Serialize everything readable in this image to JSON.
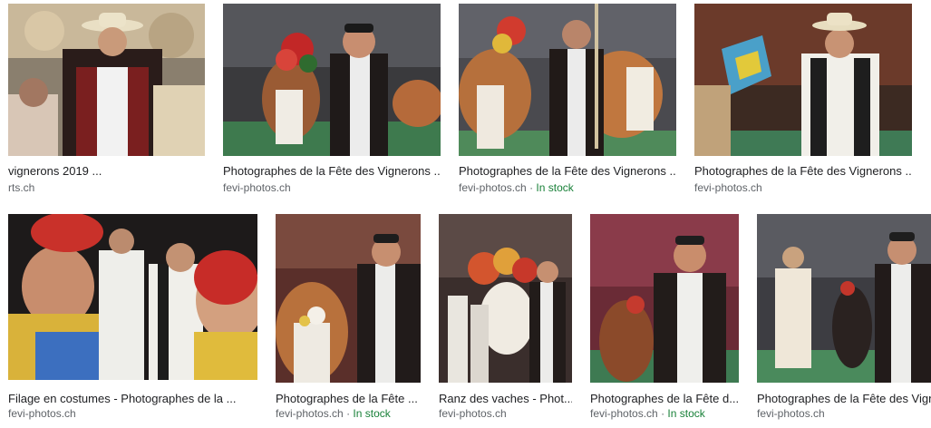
{
  "results": [
    {
      "title": "vignerons 2019 ...",
      "source": "rts.ch",
      "in_stock": ""
    },
    {
      "title": "Photographes de la Fête des Vignerons ...",
      "source": "fevi-photos.ch",
      "in_stock": ""
    },
    {
      "title": "Photographes de la Fête des Vignerons ...",
      "source": "fevi-photos.ch",
      "in_stock": "In stock"
    },
    {
      "title": "Photographes de la Fête des Vignerons ...",
      "source": "fevi-photos.ch",
      "in_stock": ""
    },
    {
      "title": "Filage en costumes - Photographes de la ...",
      "source": "fevi-photos.ch",
      "in_stock": ""
    },
    {
      "title": "Photographes de la Fête ...",
      "source": "fevi-photos.ch",
      "in_stock": "In stock"
    },
    {
      "title": "Ranz des vaches - Phot...",
      "source": "fevi-photos.ch",
      "in_stock": ""
    },
    {
      "title": "Photographes de la Fête d...",
      "source": "fevi-photos.ch",
      "in_stock": "In stock"
    },
    {
      "title": "Photographes de la Fête des Vigne",
      "source": "fevi-photos.ch",
      "in_stock": ""
    }
  ],
  "separator": "·",
  "colors": {
    "title": "#202124",
    "source": "#5f6368",
    "in_stock": "#188038"
  },
  "icons": {
    "thumbnails": "photo-thumbnail"
  }
}
